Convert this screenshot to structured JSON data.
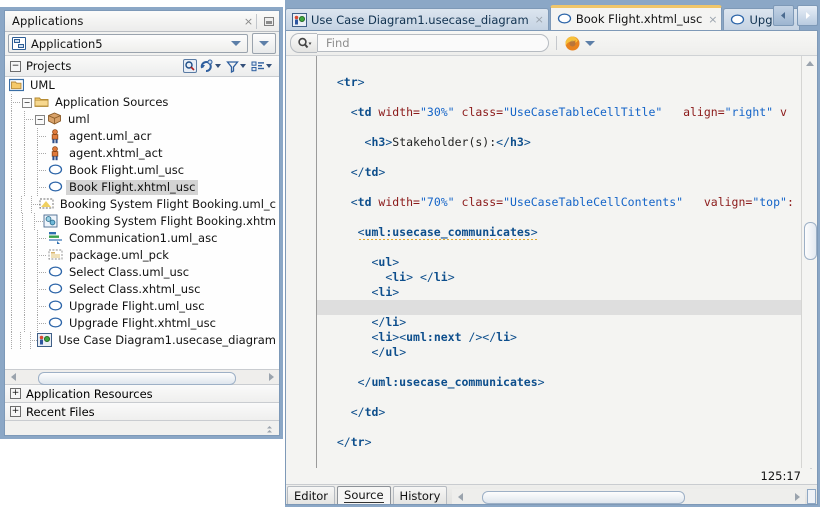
{
  "applications_panel": {
    "title": "Applications",
    "close_label": "×",
    "minimize_label": "minimize",
    "selected_application": "Application5",
    "projects_label": "Projects",
    "toolbar_icons": [
      "search-project-icon",
      "refresh-icon",
      "filter-icon",
      "group-by-icon"
    ],
    "tree": [
      {
        "label": "UML",
        "depth": 0,
        "icon": "project-folder-icon",
        "toggle": "",
        "selected": false
      },
      {
        "label": "Application Sources",
        "depth": 1,
        "icon": "folder-icon",
        "toggle": "-",
        "selected": false
      },
      {
        "label": "uml",
        "depth": 2,
        "icon": "package-icon",
        "toggle": "-",
        "selected": false
      },
      {
        "label": "agent.uml_acr",
        "depth": 3,
        "icon": "actor-icon",
        "toggle": "",
        "selected": false
      },
      {
        "label": "agent.xhtml_act",
        "depth": 3,
        "icon": "actor-icon",
        "toggle": "",
        "selected": false
      },
      {
        "label": "Book Flight.uml_usc",
        "depth": 3,
        "icon": "usecase-oval-icon",
        "toggle": "",
        "selected": false
      },
      {
        "label": "Book Flight.xhtml_usc",
        "depth": 3,
        "icon": "usecase-oval-icon",
        "toggle": "",
        "selected": true
      },
      {
        "label": "Booking System Flight Booking.uml_c",
        "depth": 3,
        "icon": "diagram-icon",
        "toggle": "",
        "selected": false
      },
      {
        "label": "Booking System Flight Booking.xhtm",
        "depth": 3,
        "icon": "component-icon",
        "toggle": "",
        "selected": false
      },
      {
        "label": "Communication1.uml_asc",
        "depth": 3,
        "icon": "communication-icon",
        "toggle": "",
        "selected": false
      },
      {
        "label": "package.uml_pck",
        "depth": 3,
        "icon": "package-file-icon",
        "toggle": "",
        "selected": false
      },
      {
        "label": "Select Class.uml_usc",
        "depth": 3,
        "icon": "usecase-oval-icon",
        "toggle": "",
        "selected": false
      },
      {
        "label": "Select Class.xhtml_usc",
        "depth": 3,
        "icon": "usecase-oval-icon",
        "toggle": "",
        "selected": false
      },
      {
        "label": "Upgrade Flight.uml_usc",
        "depth": 3,
        "icon": "usecase-oval-icon",
        "toggle": "",
        "selected": false
      },
      {
        "label": "Upgrade Flight.xhtml_usc",
        "depth": 3,
        "icon": "usecase-oval-icon",
        "toggle": "",
        "selected": false
      },
      {
        "label": "Use Case Diagram1.usecase_diagram",
        "depth": 3,
        "icon": "usecase-diagram-icon",
        "toggle": "",
        "selected": false
      }
    ],
    "sections": [
      {
        "label": "Application Resources",
        "toggle": "+"
      },
      {
        "label": "Recent Files",
        "toggle": "+"
      }
    ]
  },
  "editor": {
    "tabs": [
      {
        "label": "Use Case Diagram1.usecase_diagram",
        "icon": "usecase-diagram-icon",
        "close": "×",
        "active": false
      },
      {
        "label": "Book Flight.xhtml_usc",
        "icon": "usecase-oval-icon",
        "close": "×",
        "active": true
      },
      {
        "label": "Upgra...",
        "icon": "usecase-oval-icon",
        "close": "",
        "active": false
      }
    ],
    "tab_nav": {
      "prev": "prev-tab-arrow",
      "next": "next-tab-arrow"
    },
    "findbar": {
      "search_icon": "search-icon",
      "placeholder": "Find",
      "value": "",
      "browser_icon": "firefox-icon",
      "browser_caret": "chevron-down-icon"
    },
    "code_lines": [
      {
        "indent": 2,
        "highlight": false,
        "tokens": [
          {
            "t": "punct",
            "v": "<"
          },
          {
            "t": "tag",
            "v": "tr"
          },
          {
            "t": "punct",
            "v": ">"
          }
        ]
      },
      {
        "indent": 0,
        "highlight": false,
        "tokens": []
      },
      {
        "indent": 4,
        "highlight": false,
        "tokens": [
          {
            "t": "punct",
            "v": "<"
          },
          {
            "t": "tag",
            "v": "td"
          },
          {
            "t": "attr",
            "v": " width="
          },
          {
            "t": "val",
            "v": "\"30%\""
          },
          {
            "t": "attr",
            "v": " class="
          },
          {
            "t": "val",
            "v": "\"UseCaseTableCellTitle\""
          },
          {
            "t": "attr",
            "v": "   align="
          },
          {
            "t": "val",
            "v": "\"right\""
          },
          {
            "t": "attr",
            "v": " v"
          }
        ]
      },
      {
        "indent": 0,
        "highlight": false,
        "tokens": []
      },
      {
        "indent": 6,
        "highlight": false,
        "tokens": [
          {
            "t": "punct",
            "v": "<"
          },
          {
            "t": "tag",
            "v": "h3"
          },
          {
            "t": "punct",
            "v": ">"
          },
          {
            "t": "txt",
            "v": "Stakeholder(s):"
          },
          {
            "t": "punct",
            "v": "</"
          },
          {
            "t": "tag",
            "v": "h3"
          },
          {
            "t": "punct",
            "v": ">"
          }
        ]
      },
      {
        "indent": 0,
        "highlight": false,
        "tokens": []
      },
      {
        "indent": 4,
        "highlight": false,
        "tokens": [
          {
            "t": "punct",
            "v": "</"
          },
          {
            "t": "tag",
            "v": "td"
          },
          {
            "t": "punct",
            "v": ">"
          }
        ]
      },
      {
        "indent": 0,
        "highlight": false,
        "tokens": []
      },
      {
        "indent": 4,
        "highlight": false,
        "tokens": [
          {
            "t": "punct",
            "v": "<"
          },
          {
            "t": "tag",
            "v": "td"
          },
          {
            "t": "attr",
            "v": " width="
          },
          {
            "t": "val",
            "v": "\"70%\""
          },
          {
            "t": "attr",
            "v": " class="
          },
          {
            "t": "val",
            "v": "\"UseCaseTableCellContents\""
          },
          {
            "t": "attr",
            "v": "   valign="
          },
          {
            "t": "val",
            "v": "\"top\""
          },
          {
            "t": "attr",
            "v": ":"
          }
        ]
      },
      {
        "indent": 0,
        "highlight": false,
        "tokens": []
      },
      {
        "indent": 5,
        "highlight": false,
        "squiggly": true,
        "tokens": [
          {
            "t": "punct",
            "v": "<"
          },
          {
            "t": "tag",
            "v": "uml:usecase_communicates"
          },
          {
            "t": "punct",
            "v": ">"
          }
        ]
      },
      {
        "indent": 0,
        "highlight": false,
        "tokens": []
      },
      {
        "indent": 7,
        "highlight": false,
        "tokens": [
          {
            "t": "punct",
            "v": "<"
          },
          {
            "t": "tag",
            "v": "ul"
          },
          {
            "t": "punct",
            "v": ">"
          }
        ]
      },
      {
        "indent": 9,
        "highlight": false,
        "tokens": [
          {
            "t": "punct",
            "v": "<"
          },
          {
            "t": "tag",
            "v": "li"
          },
          {
            "t": "punct",
            "v": ">"
          },
          {
            "t": "txt",
            "v": " "
          },
          {
            "t": "punct",
            "v": "</"
          },
          {
            "t": "tag",
            "v": "li"
          },
          {
            "t": "punct",
            "v": ">"
          }
        ]
      },
      {
        "indent": 7,
        "highlight": false,
        "tokens": [
          {
            "t": "punct",
            "v": "<"
          },
          {
            "t": "tag",
            "v": "li"
          },
          {
            "t": "punct",
            "v": ">"
          }
        ]
      },
      {
        "indent": 0,
        "highlight": true,
        "tokens": []
      },
      {
        "indent": 7,
        "highlight": false,
        "tokens": [
          {
            "t": "punct",
            "v": "</"
          },
          {
            "t": "tag",
            "v": "li"
          },
          {
            "t": "punct",
            "v": ">"
          }
        ]
      },
      {
        "indent": 7,
        "highlight": false,
        "tokens": [
          {
            "t": "punct",
            "v": "<"
          },
          {
            "t": "tag",
            "v": "li"
          },
          {
            "t": "punct",
            "v": "><"
          },
          {
            "t": "tag",
            "v": "uml:next"
          },
          {
            "t": "punct",
            "v": " /></"
          },
          {
            "t": "tag",
            "v": "li"
          },
          {
            "t": "punct",
            "v": ">"
          }
        ]
      },
      {
        "indent": 7,
        "highlight": false,
        "tokens": [
          {
            "t": "punct",
            "v": "</"
          },
          {
            "t": "tag",
            "v": "ul"
          },
          {
            "t": "punct",
            "v": ">"
          }
        ]
      },
      {
        "indent": 0,
        "highlight": false,
        "tokens": []
      },
      {
        "indent": 5,
        "highlight": false,
        "tokens": [
          {
            "t": "punct",
            "v": "</"
          },
          {
            "t": "tag",
            "v": "uml:usecase_communicates"
          },
          {
            "t": "punct",
            "v": ">"
          }
        ]
      },
      {
        "indent": 0,
        "highlight": false,
        "tokens": []
      },
      {
        "indent": 4,
        "highlight": false,
        "tokens": [
          {
            "t": "punct",
            "v": "</"
          },
          {
            "t": "tag",
            "v": "td"
          },
          {
            "t": "punct",
            "v": ">"
          }
        ]
      },
      {
        "indent": 0,
        "highlight": false,
        "tokens": []
      },
      {
        "indent": 2,
        "highlight": false,
        "tokens": [
          {
            "t": "punct",
            "v": "</"
          },
          {
            "t": "tag",
            "v": "tr"
          },
          {
            "t": "punct",
            "v": ">"
          }
        ]
      }
    ],
    "caret_position": "125:17",
    "bottom_tabs": [
      {
        "label": "Editor",
        "active": false
      },
      {
        "label": "Source",
        "active": true
      },
      {
        "label": "History",
        "active": false
      }
    ]
  },
  "colors": {
    "window_chrome": "#8ba7c6",
    "panel_bg": "#f2f2f0",
    "editor_bg": "#f4f4f2",
    "tag": "#0d4e8c",
    "attribute": "#8b1a1a",
    "attribute_value": "#1464c8",
    "selection": "#d4d4d4",
    "active_line": "#dedede",
    "active_tab_accent": "#f0c66a",
    "squiggly_warning": "#e0a218"
  }
}
